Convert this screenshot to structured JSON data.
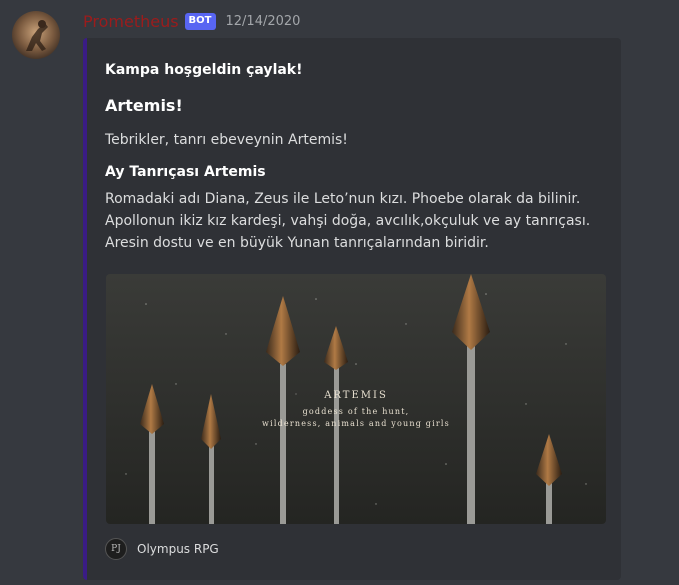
{
  "message": {
    "username": "Prometheus",
    "bot_tag": "BOT",
    "timestamp": "12/14/2020",
    "username_color": "#9b1c1c"
  },
  "embed": {
    "accent_color": "#3a1c85",
    "author": "Kampa hoşgeldin çaylak!",
    "title": "Artemis!",
    "description": "Tebrikler, tanrı ebeveynin Artemis!",
    "field": {
      "name": "Ay Tanrıçası Artemis",
      "value_lines": [
        "Romadaki adı Diana, Zeus ile Leto’nun kızı. Phoebe olarak da bilinir.",
        "Apollonun ikiz kız kardeşi, vahşi doğa, avcılık,okçuluk ve ay tanrıçası.",
        "Aresin dostu ve en büyük Yunan tanrıçalarından biridir."
      ]
    },
    "image": {
      "title": "ARTEMIS",
      "subtitle_lines": [
        "goddess of the hunt,",
        "wilderness, animals and young girls"
      ]
    },
    "footer": {
      "icon_text": "PJ",
      "text": "Olympus RPG"
    }
  }
}
